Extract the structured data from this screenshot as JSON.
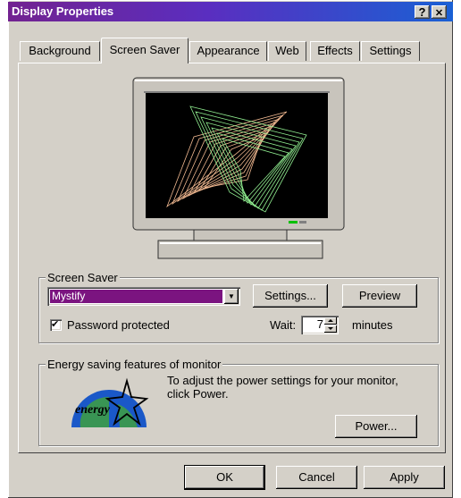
{
  "window": {
    "title": "Display Properties",
    "help_glyph": "?",
    "close_glyph": "✕"
  },
  "tabs": [
    {
      "label": "Background"
    },
    {
      "label": "Screen Saver"
    },
    {
      "label": "Appearance"
    },
    {
      "label": "Web"
    },
    {
      "label": "Effects"
    },
    {
      "label": "Settings"
    }
  ],
  "screensaver": {
    "group_label": "Screen Saver",
    "selected": "Mystify",
    "dropdown_arrow": "▼",
    "settings_button": "Settings...",
    "preview_button": "Preview",
    "password_checked": true,
    "password_label": "Password protected",
    "check_glyph": "✔",
    "wait_label": "Wait:",
    "wait_value": "7",
    "wait_units": "minutes"
  },
  "energy": {
    "group_label": "Energy saving features of monitor",
    "description": "To adjust the power settings for your monitor, click Power.",
    "power_button": "Power...",
    "logo_text": "energy"
  },
  "footer": {
    "ok": "OK",
    "cancel": "Cancel",
    "apply": "Apply"
  },
  "colors": {
    "title_gradient_start": "#722290",
    "title_gradient_end": "#1a60d4",
    "selection": "#7b1480",
    "mystify_orange": "#f0b890",
    "mystify_green": "#90ee90",
    "dialog_face": "#d4d0c8"
  }
}
